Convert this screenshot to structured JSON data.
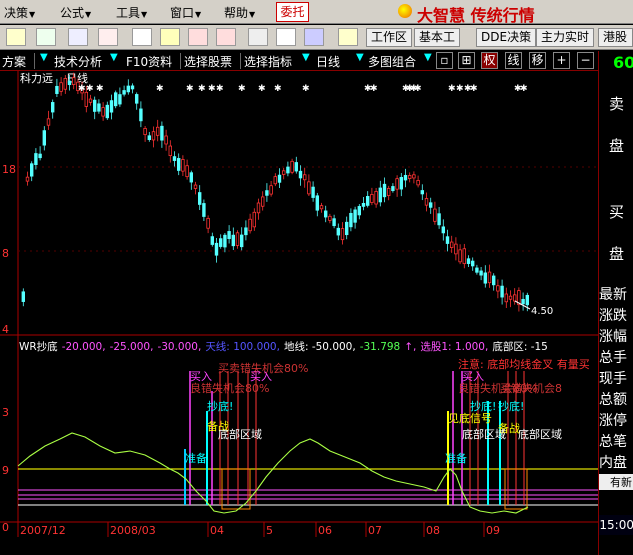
{
  "menu": {
    "items": [
      {
        "label": "决策",
        "x": 4
      },
      {
        "label": "公式",
        "x": 60
      },
      {
        "label": "工具",
        "x": 116
      },
      {
        "label": "窗口",
        "x": 170
      },
      {
        "label": "帮助",
        "x": 224
      }
    ],
    "weituo": "委托",
    "brand": "大智慧 传统行情"
  },
  "toolbar": {
    "workzone": "工作区",
    "layout": "基本工",
    "dde": "DDE决策",
    "main_realtime": "主力实时",
    "market": "港股"
  },
  "tabs": {
    "plan": "方案",
    "tech": "技术分析",
    "f10": "F10资料",
    "pick_stock": "选择股票",
    "pick_indicator": "选择指标",
    "period": "日线",
    "multi_combo": "多图组合",
    "quan": "权",
    "xian": "线",
    "yi": "移"
  },
  "chart": {
    "stock_name": "科力远",
    "period_label": "日线",
    "price_label": "4.50",
    "y_ticks": [
      "18",
      "8",
      "4"
    ],
    "indicator_header": [
      {
        "text": "WR抄底",
        "color": "#ffffff"
      },
      {
        "text": "-20.000,",
        "color": "#ff55ff"
      },
      {
        "text": "-25.000,",
        "color": "#ff55ff"
      },
      {
        "text": "-30.000,",
        "color": "#ff55ff"
      },
      {
        "text": "天线: 100.000,",
        "color": "#5555ff"
      },
      {
        "text": "地线: -50.000,",
        "color": "#ffffff"
      },
      {
        "text": "-31.798",
        "color": "#55ff55"
      },
      {
        "text": "↑,",
        "color": "#ff55ff"
      },
      {
        "text": "选股1: 1.000,",
        "color": "#ff55ff"
      },
      {
        "text": "底部区: -15",
        "color": "#ffffff"
      }
    ],
    "ind_y_ticks": [
      "3",
      "9",
      "0"
    ],
    "x_axis": [
      "2007/12",
      "2008/03",
      "04",
      "5",
      "06",
      "07",
      "08",
      "09"
    ],
    "annotations": [
      {
        "text": "买入",
        "color": "#ff44ff"
      },
      {
        "text": "良错失机会80%",
        "color": "#cc3333"
      },
      {
        "text": "买卖错失机会80%",
        "color": "#cc3333"
      },
      {
        "text": "买入",
        "color": "#ff44ff"
      },
      {
        "text": "抄底!",
        "color": "#00ffff"
      },
      {
        "text": "备战",
        "color": "#ffff00"
      },
      {
        "text": "底部区域",
        "color": "#ffffff"
      },
      {
        "text": "准备",
        "color": "#00ffff"
      },
      {
        "text": "注意: 底部均线金叉 有量买",
        "color": "#ff3333"
      },
      {
        "text": "买入",
        "color": "#ff44ff"
      },
      {
        "text": "良错失机会80%",
        "color": "#cc3333"
      },
      {
        "text": "买错失机会8",
        "color": "#cc3333"
      },
      {
        "text": "抄底!",
        "color": "#00ffff"
      },
      {
        "text": "抄底!",
        "color": "#00ffff"
      },
      {
        "text": "见底信号",
        "color": "#ffff00"
      },
      {
        "text": "备战",
        "color": "#ffff00"
      },
      {
        "text": "底部区域",
        "color": "#ffffff"
      },
      {
        "text": "底部区域",
        "color": "#ffffff"
      },
      {
        "text": "准备",
        "color": "#00ffff"
      }
    ]
  },
  "right_panel": {
    "price": "60",
    "sell_1": "卖",
    "sell_2": "盘",
    "buy_1": "买",
    "buy_2": "盘",
    "tabs": [
      "最新",
      "涨跌",
      "涨幅",
      "总手",
      "现手",
      "总额",
      "涨停",
      "总笔",
      "内盘"
    ],
    "youzhi": "有新",
    "time": "15:00"
  },
  "colors": {
    "up": "#ff3333",
    "down": "#55ffff",
    "wr_line": "#aaff44",
    "axis": "#aa0000"
  }
}
